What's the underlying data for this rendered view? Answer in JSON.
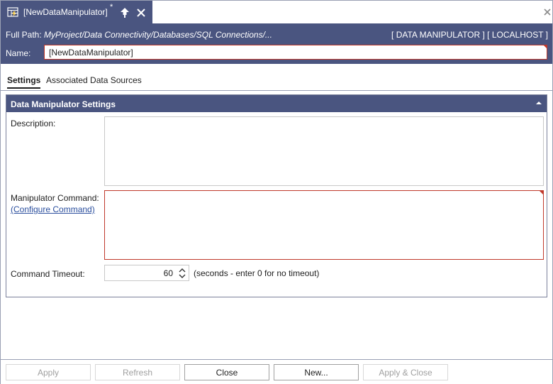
{
  "tab": {
    "title": "[NewDataManipulator]",
    "modified_marker": "*",
    "icon": "data-manipulator-icon",
    "pin_icon": "pin-icon",
    "close_icon": "close-icon"
  },
  "window": {
    "close_icon": "close-icon"
  },
  "header": {
    "full_path_label": "Full Path:",
    "full_path_value": "MyProject/Data Connectivity/Databases/SQL Connections/...",
    "context": "[ DATA MANIPULATOR ] [ LOCALHOST ]",
    "name_label": "Name:",
    "name_value": "[NewDataManipulator]"
  },
  "subtabs": [
    {
      "label": "Settings",
      "active": true
    },
    {
      "label": "Associated Data Sources",
      "active": false
    }
  ],
  "group": {
    "title": "Data Manipulator Settings",
    "collapse_icon": "chevron-up-icon",
    "description_label": "Description:",
    "description_value": "",
    "command_label": "Manipulator Command:",
    "configure_link": "(Configure Command)",
    "command_value": "",
    "timeout_label": "Command Timeout:",
    "timeout_value": "60",
    "timeout_hint": "(seconds - enter 0 for no timeout)"
  },
  "buttons": {
    "apply": "Apply",
    "refresh": "Refresh",
    "close": "Close",
    "new": "New...",
    "apply_close": "Apply & Close"
  },
  "colors": {
    "header_bg": "#4a5580",
    "required_border": "#c0392b",
    "link": "#2b4f9e"
  }
}
